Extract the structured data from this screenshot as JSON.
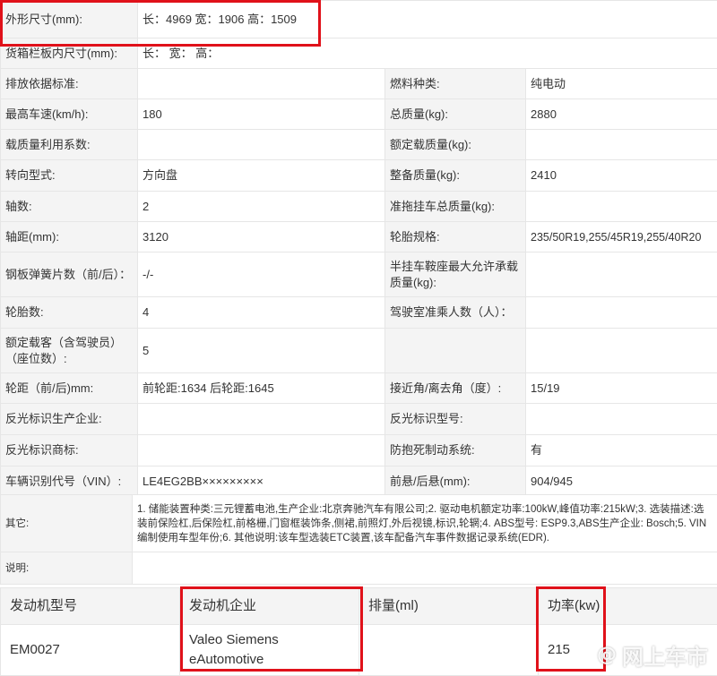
{
  "specs": {
    "dimensions_label": "外形尺寸(mm):",
    "dimensions_value": "长：4969 宽：1906 高：1509",
    "cargo_label": "货箱栏板内尺寸(mm):",
    "cargo_value": "长：  宽：  高：",
    "rows": [
      [
        "排放依据标准:",
        "",
        "燃料种类:",
        "纯电动"
      ],
      [
        "最高车速(km/h):",
        "180",
        "总质量(kg):",
        "2880"
      ],
      [
        "载质量利用系数:",
        "",
        "额定载质量(kg):",
        ""
      ],
      [
        "转向型式:",
        "方向盘",
        "整备质量(kg):",
        "2410"
      ],
      [
        "轴数:",
        "2",
        "准拖挂车总质量(kg):",
        ""
      ],
      [
        "轴距(mm):",
        "3120",
        "轮胎规格:",
        "235/50R19,255/45R19,255/40R20"
      ],
      [
        "钢板弹簧片数（前/后）：",
        "-/-",
        "半挂车鞍座最大允许承载质量(kg):",
        ""
      ],
      [
        "轮胎数:",
        "4",
        "驾驶室准乘人数（人）：",
        ""
      ],
      [
        "额定载客（含驾驶员）（座位数）:",
        "5",
        "",
        ""
      ],
      [
        "轮距（前/后)mm:",
        "前轮距:1634 后轮距:1645",
        "接近角/离去角（度）:",
        "15/19"
      ],
      [
        "反光标识生产企业:",
        "",
        "反光标识型号:",
        ""
      ],
      [
        "反光标识商标:",
        "",
        "防抱死制动系统:",
        "有"
      ],
      [
        "车辆识别代号（VIN）:",
        "LE4EG2BB×××××××××",
        "前悬/后悬(mm):",
        "904/945"
      ]
    ]
  },
  "notes": {
    "other_label": "其它:",
    "other_value": "1. 储能装置种类:三元锂蓄电池,生产企业:北京奔驰汽车有限公司;2. 驱动电机额定功率:100kW,峰值功率:215kW;3. 选装描述:选装前保险杠,后保险杠,前格栅,门窗框装饰条,侧裙,前照灯,外后视镜,标识,轮辋;4. ABS型号: ESP9.3,ABS生产企业: Bosch;5. VIN编制使用车型年份;6. 其他说明:该车型选装ETC装置,该车配备汽车事件数据记录系统(EDR).",
    "desc_label": "说明:",
    "desc_value": ""
  },
  "engine": {
    "headers": [
      "发动机型号",
      "发动机企业",
      "排量(ml)",
      "功率(kw)"
    ],
    "row": [
      "EM0027",
      "Valeo Siemens eAutomotive",
      "",
      "215"
    ]
  },
  "watermark": {
    "at": "@",
    "text": "网上车市"
  },
  "colors": {
    "highlight": "#e0111a",
    "label_bg": "#f4f4f4",
    "border": "#e6e6e6"
  }
}
